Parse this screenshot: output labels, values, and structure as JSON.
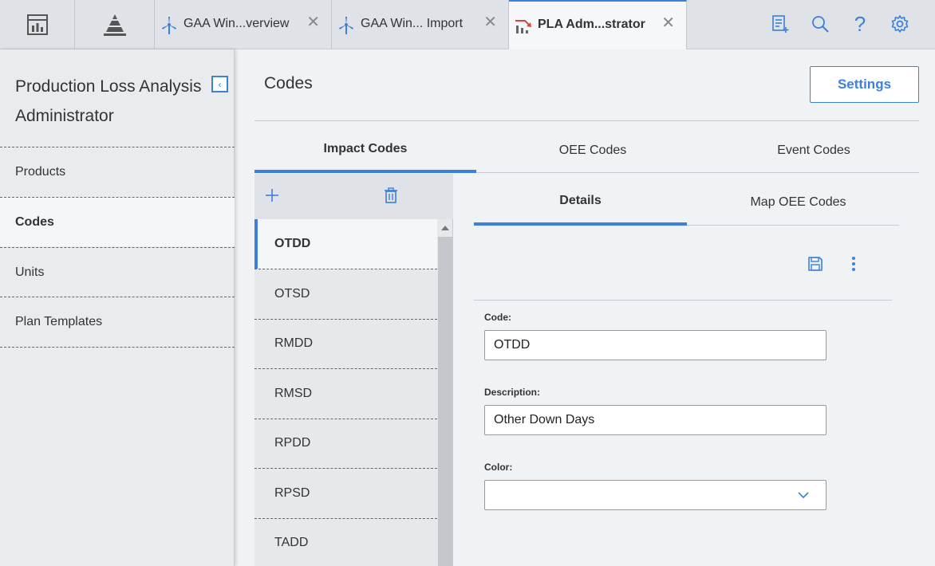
{
  "topbar": {
    "tabs": [
      {
        "label": "GAA Win...verview",
        "icon": "wind-turbine-icon",
        "closable": true,
        "active": false
      },
      {
        "label": "GAA Win... Import",
        "icon": "wind-turbine-icon",
        "closable": true,
        "active": false
      },
      {
        "label": "PLA Adm...strator",
        "icon": "production-loss-chart-icon",
        "closable": true,
        "active": true
      }
    ],
    "close_glyph": "✕",
    "left_icons": [
      "dashboard-icon",
      "pyramid-icon"
    ],
    "right_icons": [
      "checklist-add-icon",
      "search-icon",
      "help-icon",
      "settings-gear-icon"
    ],
    "help_glyph": "?"
  },
  "sidebar": {
    "title": "Production Loss Analysis Administrator",
    "collapse_glyph": "‹",
    "items": [
      {
        "label": "Products",
        "active": false
      },
      {
        "label": "Codes",
        "active": true
      },
      {
        "label": "Units",
        "active": false
      },
      {
        "label": "Plan Templates",
        "active": false
      }
    ]
  },
  "main": {
    "title": "Codes",
    "settings_label": "Settings",
    "code_tabs": [
      {
        "label": "Impact Codes",
        "active": true
      },
      {
        "label": "OEE Codes",
        "active": false
      },
      {
        "label": "Event Codes",
        "active": false
      }
    ],
    "list": {
      "add_icon": "plus-icon",
      "delete_icon": "trash-icon",
      "items": [
        "OTDD",
        "OTSD",
        "RMDD",
        "RMSD",
        "RPDD",
        "RPSD",
        "TADD"
      ],
      "selected": "OTDD"
    },
    "details": {
      "tabs": [
        {
          "label": "Details",
          "active": true
        },
        {
          "label": "Map OEE Codes",
          "active": false
        }
      ],
      "fields": {
        "code": {
          "label": "Code:",
          "value": "OTDD"
        },
        "description": {
          "label": "Description:",
          "value": "Other Down Days"
        },
        "color": {
          "label": "Color:",
          "value": ""
        }
      }
    }
  },
  "colors": {
    "accent": "#3d7fd9",
    "topbar_bg": "#dfe3e7",
    "sidebar_bg": "#e9ecef"
  }
}
